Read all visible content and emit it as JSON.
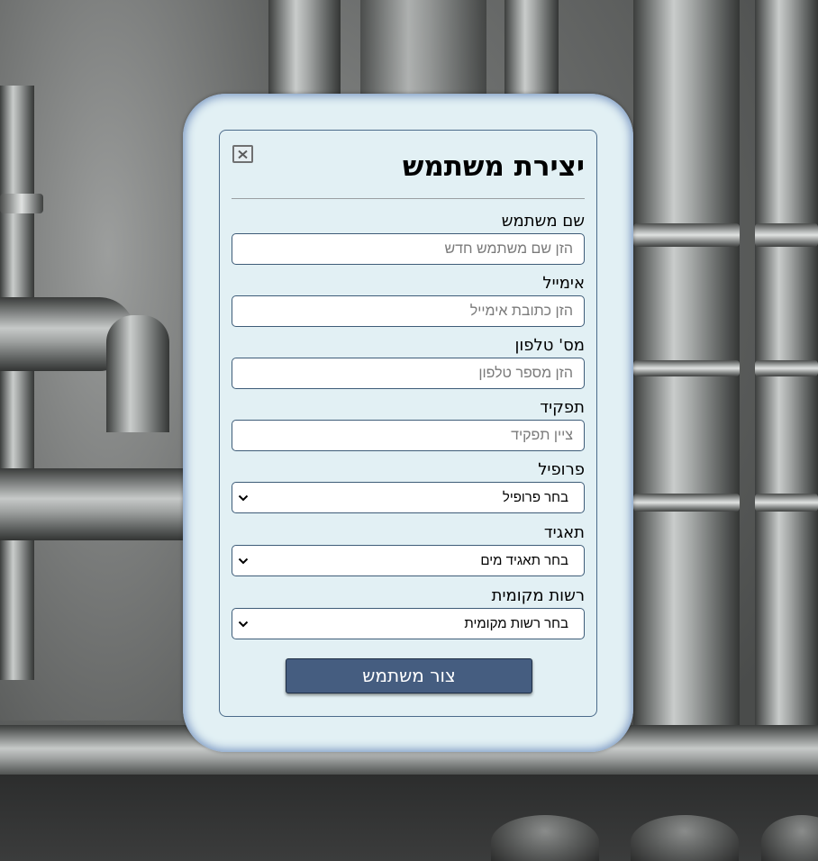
{
  "form": {
    "title": "יצירת משתמש",
    "close_icon": "close-icon",
    "fields": {
      "username": {
        "label": "שם משתמש",
        "placeholder": "הזן שם משתמש חדש",
        "value": ""
      },
      "email": {
        "label": "אימייל",
        "placeholder": "הזן כתובת אימייל",
        "value": ""
      },
      "phone": {
        "label": "מס' טלפון",
        "placeholder": "הזן מספר טלפון",
        "value": ""
      },
      "role": {
        "label": "תפקיד",
        "placeholder": "ציין תפקיד",
        "value": ""
      }
    },
    "selects": {
      "profile": {
        "label": "פרופיל",
        "selected": "בחר פרופיל",
        "icon": "chevron-down-icon"
      },
      "corporation": {
        "label": "תאגיד",
        "selected": "בחר תאגיד מים",
        "icon": "chevron-down-icon"
      },
      "authority": {
        "label": "רשות מקומית",
        "selected": "בחר רשות מקומית",
        "icon": "chevron-down-icon"
      }
    },
    "submit_label": "צור משתמש"
  },
  "colors": {
    "card_background": "#e2f0f4",
    "card_glow": "#7f9bc4",
    "button_background": "#455d80",
    "field_border": "#3e5c78"
  }
}
